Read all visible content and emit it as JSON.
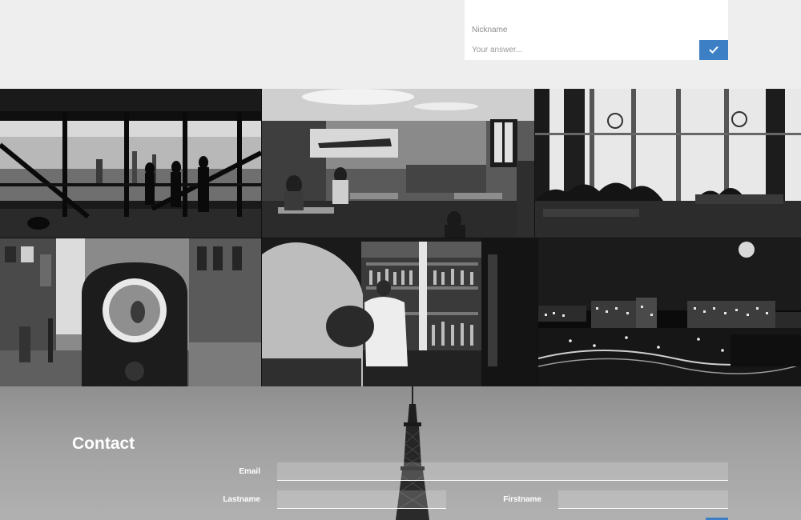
{
  "nickname_form": {
    "label": "Nickname",
    "placeholder": "Your answer...",
    "submit_icon": "check-icon",
    "accent_color": "#3c7fc4"
  },
  "gallery": {
    "tiles": [
      {
        "subject": "skyline-observation-deck-photo"
      },
      {
        "subject": "restaurant-interior-photo"
      },
      {
        "subject": "cafe-window-silhouettes-photo"
      },
      {
        "subject": "street-viewfinder-photo"
      },
      {
        "subject": "bartender-bar-photo"
      },
      {
        "subject": "city-night-moon-photo"
      }
    ]
  },
  "contact": {
    "title": "Contact",
    "email_label": "Email",
    "lastname_label": "Lastname",
    "firstname_label": "Firstname",
    "background_subject": "eiffel-tower-photo"
  }
}
